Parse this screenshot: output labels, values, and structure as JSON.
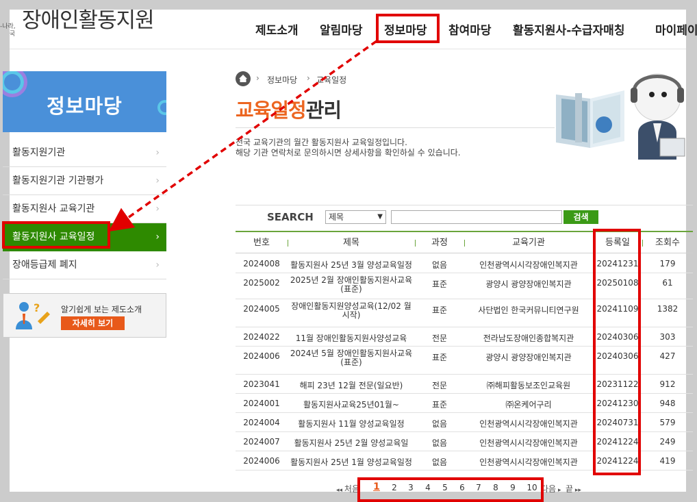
{
  "header": {
    "logo_text": "장애인활동지원",
    "logo_tag": "-나라,\n국",
    "nav": [
      {
        "label": "제도소개"
      },
      {
        "label": "알림마당"
      },
      {
        "label": "정보마당"
      },
      {
        "label": "참여마당"
      },
      {
        "label": "활동지원사-수급자매칭"
      },
      {
        "label": "마이페이"
      }
    ]
  },
  "sidebar": {
    "banner_title": "정보마당",
    "items": [
      {
        "label": "활동지원기관"
      },
      {
        "label": "활동지원기관 기관평가"
      },
      {
        "label": "활동지원사 교육기관"
      },
      {
        "label": "활동지원사 교육일정"
      },
      {
        "label": "장애등급제 폐지"
      }
    ],
    "promo_text": "알기쉽게 보는 제도소개",
    "promo_button": "자세히 보기"
  },
  "breadcrumb": [
    "정보마당",
    "교육일정"
  ],
  "page_title": {
    "highlight": "교육일정",
    "rest": "관리"
  },
  "description": [
    "전국 교육기관의 월간 활동지원사 교육일정입니다.",
    "해당 기관 연락처로 문의하시면 상세사항을 확인하실 수 있습니다."
  ],
  "search": {
    "label": "SEARCH",
    "select_value": "제목",
    "input_value": "",
    "button": "검색"
  },
  "table": {
    "columns": [
      "번호",
      "제목",
      "과정",
      "교육기관",
      "등록일",
      "조회수"
    ],
    "rows": [
      {
        "no": "2024008",
        "title": "활동지원사 25년 3월 양성교육일정",
        "course": "없음",
        "org": "인천광역시시각장애인복지관",
        "date": "20241231",
        "views": "179"
      },
      {
        "no": "2025002",
        "title": "2025년 2월 장애인활동지원사교육 (표준)",
        "course": "표준",
        "org": "광양시 광양장애인복지관",
        "date": "20250108",
        "views": "61"
      },
      {
        "no": "2024005",
        "title": "장애인활동지원양성교육(12/02 월 시작)",
        "course": "표준",
        "org": "사단법인 한국커뮤니티연구원",
        "date": "20241109",
        "views": "1382"
      },
      {
        "no": "2024022",
        "title": "11월 장애인활동지원사양성교육",
        "course": "전문",
        "org": "전라남도장애인종합복지관",
        "date": "20240306",
        "views": "303"
      },
      {
        "no": "2024006",
        "title": "2024년 5월 장애인활동지원사교육 (표준)",
        "course": "표준",
        "org": "광양시 광양장애인복지관",
        "date": "20240306",
        "views": "427"
      },
      {
        "no": "2023041",
        "title": "해피 23년 12월 전문(일요반)",
        "course": "전문",
        "org": "㈜해피활동보조인교육원",
        "date": "20231122",
        "views": "912"
      },
      {
        "no": "2024001",
        "title": "활동지원사교육25년01월~",
        "course": "표준",
        "org": "㈜온케어구리",
        "date": "20241230",
        "views": "948"
      },
      {
        "no": "2024004",
        "title": "활동지원사 11월 양성교육일정",
        "course": "없음",
        "org": "인천광역시시각장애인복지관",
        "date": "20240731",
        "views": "579"
      },
      {
        "no": "2024007",
        "title": "활동지원사 25년 2월 양성교육일",
        "course": "없음",
        "org": "인천광역시시각장애인복지관",
        "date": "20241224",
        "views": "249"
      },
      {
        "no": "2024006",
        "title": "활동지원사 25년 1월 양성교육일정",
        "course": "없음",
        "org": "인천광역시시각장애인복지관",
        "date": "20241224",
        "views": "419"
      }
    ]
  },
  "pagination": {
    "first": "처음",
    "next": "다음",
    "last": "끝",
    "pages": [
      "1",
      "2",
      "3",
      "4",
      "5",
      "6",
      "7",
      "8",
      "9",
      "10"
    ],
    "current": "1"
  },
  "colors": {
    "accent_orange": "#ec6520",
    "active_green": "#2e8a00",
    "annotation_red": "#e10000"
  }
}
